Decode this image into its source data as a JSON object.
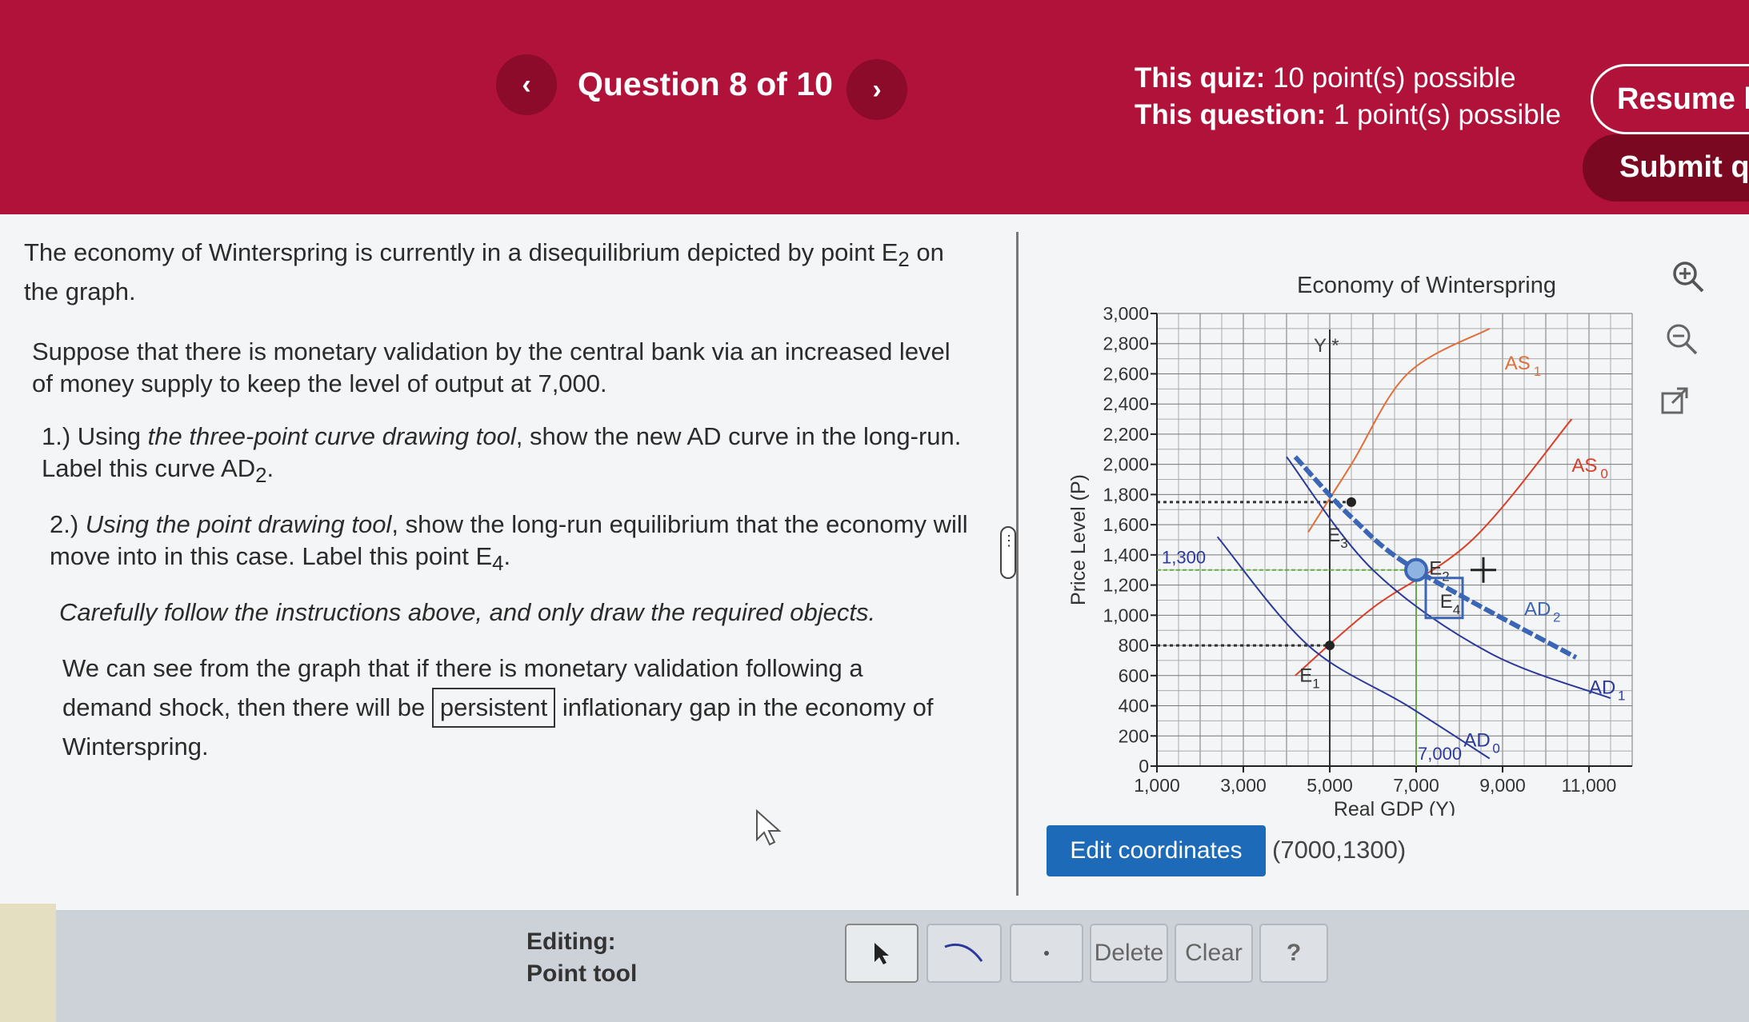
{
  "header": {
    "question_label": "Question 8 of 10",
    "quiz_points_label": "This quiz:",
    "quiz_points_value": "10 point(s) possible",
    "question_points_label": "This question:",
    "question_points_value": "1 point(s) possible",
    "resume_label": "Resume la",
    "submit_label": "Submit qu",
    "prev_glyph": "‹",
    "next_glyph": "›"
  },
  "problem": {
    "intro_line1": "The economy of Winterspring is currently in a disequilibrium depicted by point E",
    "intro_sub": "2",
    "intro_line1_end": " on",
    "intro_line2": "the graph.",
    "suppose_line1": "Suppose that there is monetary validation by the central bank via an increased level",
    "suppose_line2": "of money supply to keep the level of output at 7,000.",
    "step1_prefix": "1.) Using ",
    "step1_italic": "the three-point curve drawing tool",
    "step1_rest": ", show the new AD curve in the long-run.",
    "step1_line2": "Label this curve AD",
    "step1_sub": "2",
    "step1_end": ".",
    "step2_prefix": "2.) ",
    "step2_italic": "Using the point drawing tool",
    "step2_rest": ", show the long-run equilibrium that the economy will",
    "step2_line2": "move into in this case. Label this point E",
    "step2_sub": "4",
    "step2_end": ".",
    "careful": "Carefully follow the instructions above, and only draw the required objects.",
    "conclusion_line1": "We can see from the graph that if there is monetary validation following a",
    "conclusion_pre": "demand shock, then there will be",
    "conclusion_answer": "persistent",
    "conclusion_post": "inflationary gap in the economy of",
    "conclusion_line3": "Winterspring."
  },
  "chart_data": {
    "type": "line",
    "title": "Economy of Winterspring",
    "xlabel": "Real GDP (Y)",
    "ylabel": "Price Level (P)",
    "xlim": [
      1000,
      12000
    ],
    "ylim": [
      0,
      3000
    ],
    "x_ticks": [
      1000,
      3000,
      5000,
      7000,
      9000,
      11000
    ],
    "x_tick_labels": [
      "1,000",
      "3,000",
      "5,000",
      "7,000",
      "9,000",
      "11,000"
    ],
    "y_ticks": [
      0,
      200,
      400,
      600,
      800,
      1000,
      1200,
      1400,
      1600,
      1800,
      2000,
      2200,
      2400,
      2600,
      2800,
      3000
    ],
    "y_tick_labels": [
      "0",
      "200",
      "400",
      "600",
      "800",
      "1,000",
      "1,200",
      "1,400",
      "1,600",
      "1,800",
      "2,000",
      "2,200",
      "2,400",
      "2,600",
      "2,800",
      "3,000"
    ],
    "curves": [
      {
        "name": "AS1",
        "label": "AS",
        "sub": "1",
        "color": "#e0703a",
        "points": [
          [
            4500,
            1550
          ],
          [
            5500,
            2000
          ],
          [
            6800,
            2600
          ],
          [
            8700,
            2900
          ]
        ],
        "label_at": [
          9050,
          2630
        ]
      },
      {
        "name": "AS0",
        "label": "AS",
        "sub": "0",
        "color": "#d8402a",
        "points": [
          [
            4200,
            600
          ],
          [
            6000,
            1050
          ],
          [
            8300,
            1500
          ],
          [
            10600,
            2300
          ]
        ],
        "label_at": [
          10600,
          1950
        ]
      },
      {
        "name": "AD0",
        "label": "AD",
        "sub": "0",
        "color": "#2b3a9a",
        "points": [
          [
            2400,
            1520
          ],
          [
            4500,
            800
          ],
          [
            6800,
            400
          ],
          [
            8700,
            50
          ]
        ],
        "label_at": [
          8100,
          130
        ]
      },
      {
        "name": "AD1",
        "label": "AD",
        "sub": "1",
        "color": "#2b3a9a",
        "points": [
          [
            4000,
            2050
          ],
          [
            6000,
            1300
          ],
          [
            8700,
            750
          ],
          [
            11500,
            450
          ]
        ],
        "label_at": [
          11000,
          480
        ]
      },
      {
        "name": "AD2",
        "label": "AD",
        "sub": "2",
        "color": "#3a66b5",
        "dashed_ends": true,
        "points": [
          [
            4200,
            2050
          ],
          [
            5500,
            1650
          ],
          [
            7000,
            1300
          ],
          [
            10700,
            720
          ]
        ],
        "label_at": [
          9500,
          1000
        ]
      }
    ],
    "points": [
      {
        "name": "E1",
        "label": "E",
        "sub": "1",
        "x": 5000,
        "y": 800,
        "label_at": [
          4300,
          560
        ]
      },
      {
        "name": "E2",
        "label": "E",
        "sub": "2",
        "x": 7000,
        "y": 1300,
        "label_at": [
          7300,
          1270
        ]
      },
      {
        "name": "E3",
        "label": "E",
        "sub": "3",
        "x": 5500,
        "y": 1750,
        "label_at": [
          4950,
          1490
        ]
      },
      {
        "name": "E4",
        "label": "E",
        "sub": "4",
        "x": 7000,
        "y": 1300,
        "label_at": [
          7550,
          1050
        ]
      }
    ],
    "guides": {
      "y_star_x": 5000,
      "y_star_label": "Y *",
      "e2_y_label": "1,300",
      "e2_x_label": "7,000"
    }
  },
  "editor": {
    "edit_coords_label": "Edit coordinates",
    "coords_value": "(7000,1300)",
    "editing_label": "Editing:",
    "tool_name": "Point tool",
    "delete_label": "Delete",
    "clear_label": "Clear",
    "help_label": "?"
  },
  "colors": {
    "brand": "#b0123a",
    "accent": "#1d6ab8"
  }
}
